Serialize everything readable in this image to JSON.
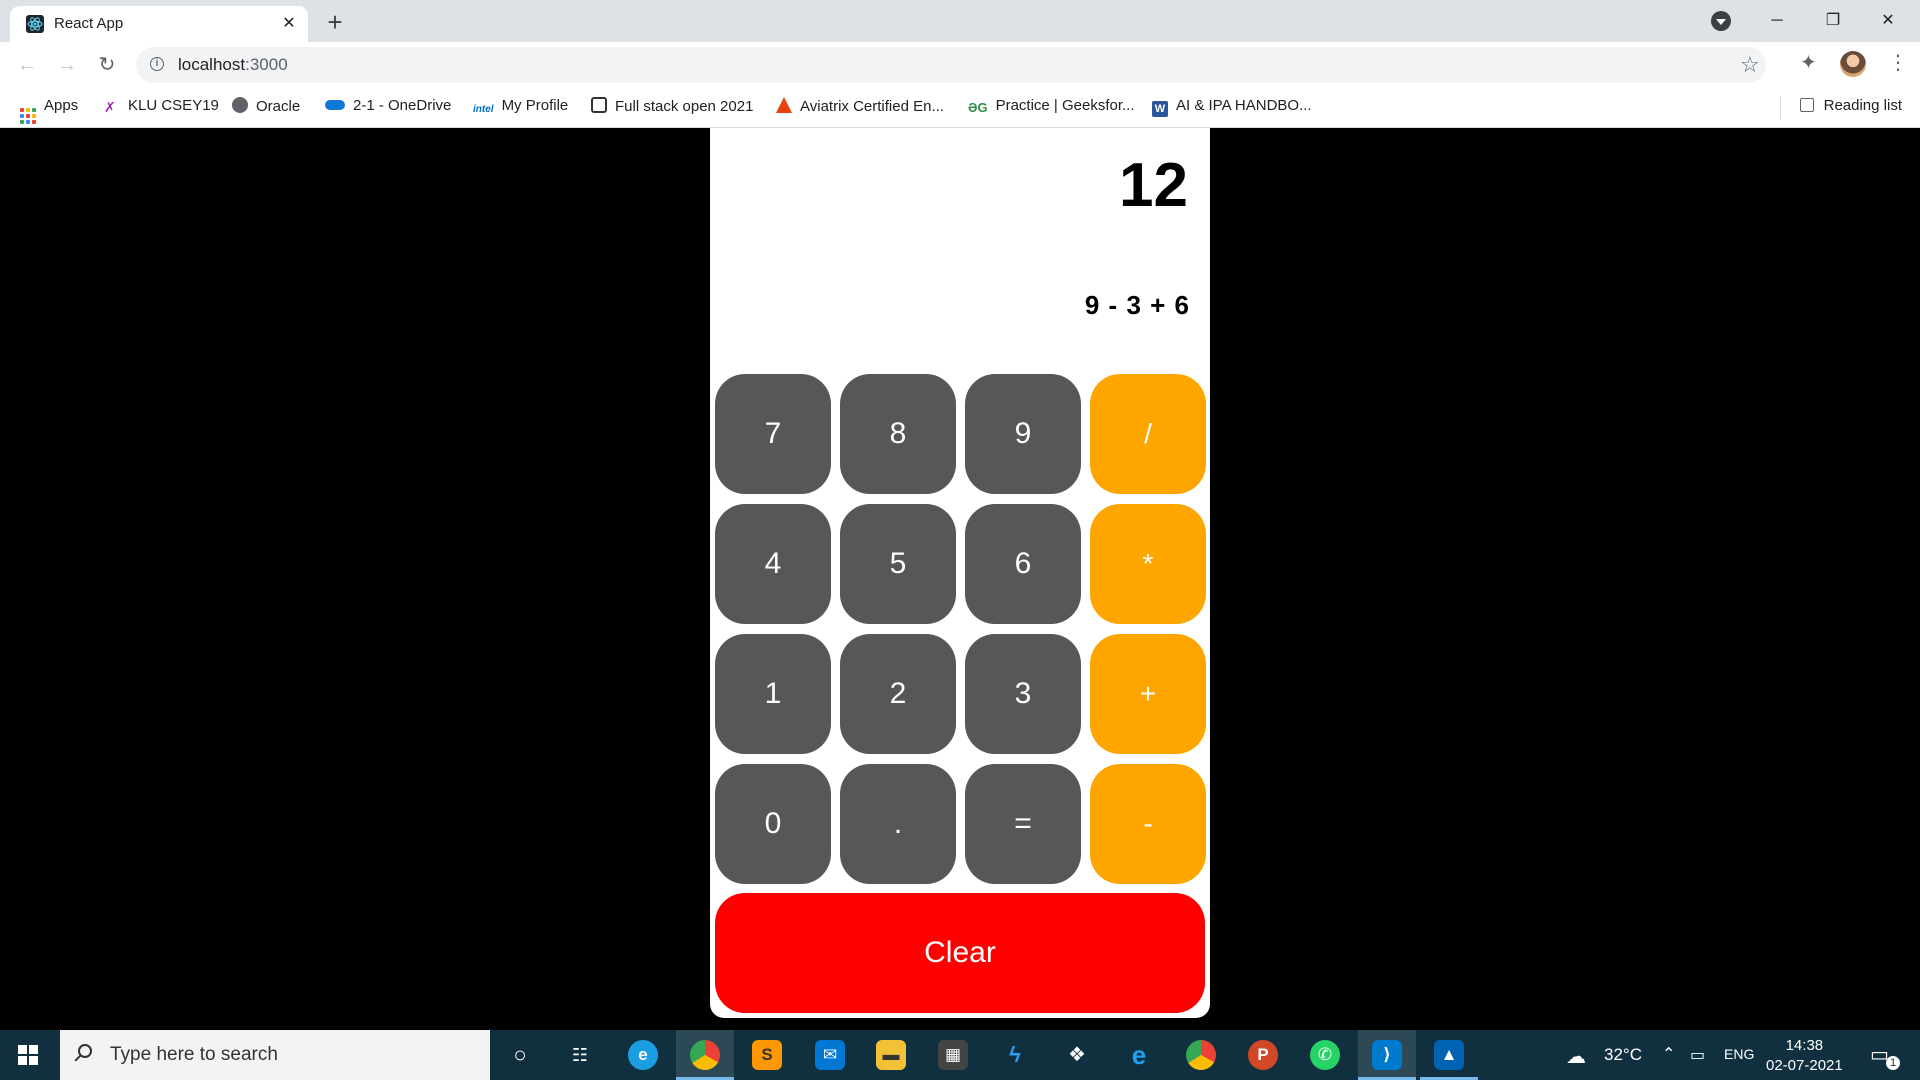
{
  "browser": {
    "tab_title": "React App",
    "tab_close": "✕",
    "new_tab": "+",
    "url_host": "localhost",
    "url_port": ":3000",
    "window_controls": {
      "minimize": "─",
      "restore": "❐",
      "close": "✕"
    }
  },
  "bookmarks": {
    "items": [
      {
        "label": "Apps"
      },
      {
        "label": "KLU CSEY19"
      },
      {
        "label": "Oracle"
      },
      {
        "label": "2-1 - OneDrive"
      },
      {
        "label": "My Profile"
      },
      {
        "label": "Full stack open 2021"
      },
      {
        "label": "Aviatrix Certified En..."
      },
      {
        "label": "Practice | Geeksfor..."
      },
      {
        "label": "AI & IPA HANDBO..."
      }
    ],
    "reading_list": "Reading list"
  },
  "calculator": {
    "result": "12",
    "expression": "9 - 3 + 6",
    "keys": [
      [
        "7",
        "8",
        "9",
        "/"
      ],
      [
        "4",
        "5",
        "6",
        "*"
      ],
      [
        "1",
        "2",
        "3",
        "+"
      ],
      [
        "0",
        ".",
        "=",
        "-"
      ]
    ],
    "clear_label": "Clear",
    "colors": {
      "number_key": "#575757",
      "operator_key": "#ffa500",
      "clear": "#ff0000"
    }
  },
  "taskbar": {
    "search_placeholder": "Type here to search",
    "weather_temp": "32°C",
    "language": "ENG",
    "time": "14:38",
    "date": "02-07-2021",
    "notification_count": "1"
  }
}
